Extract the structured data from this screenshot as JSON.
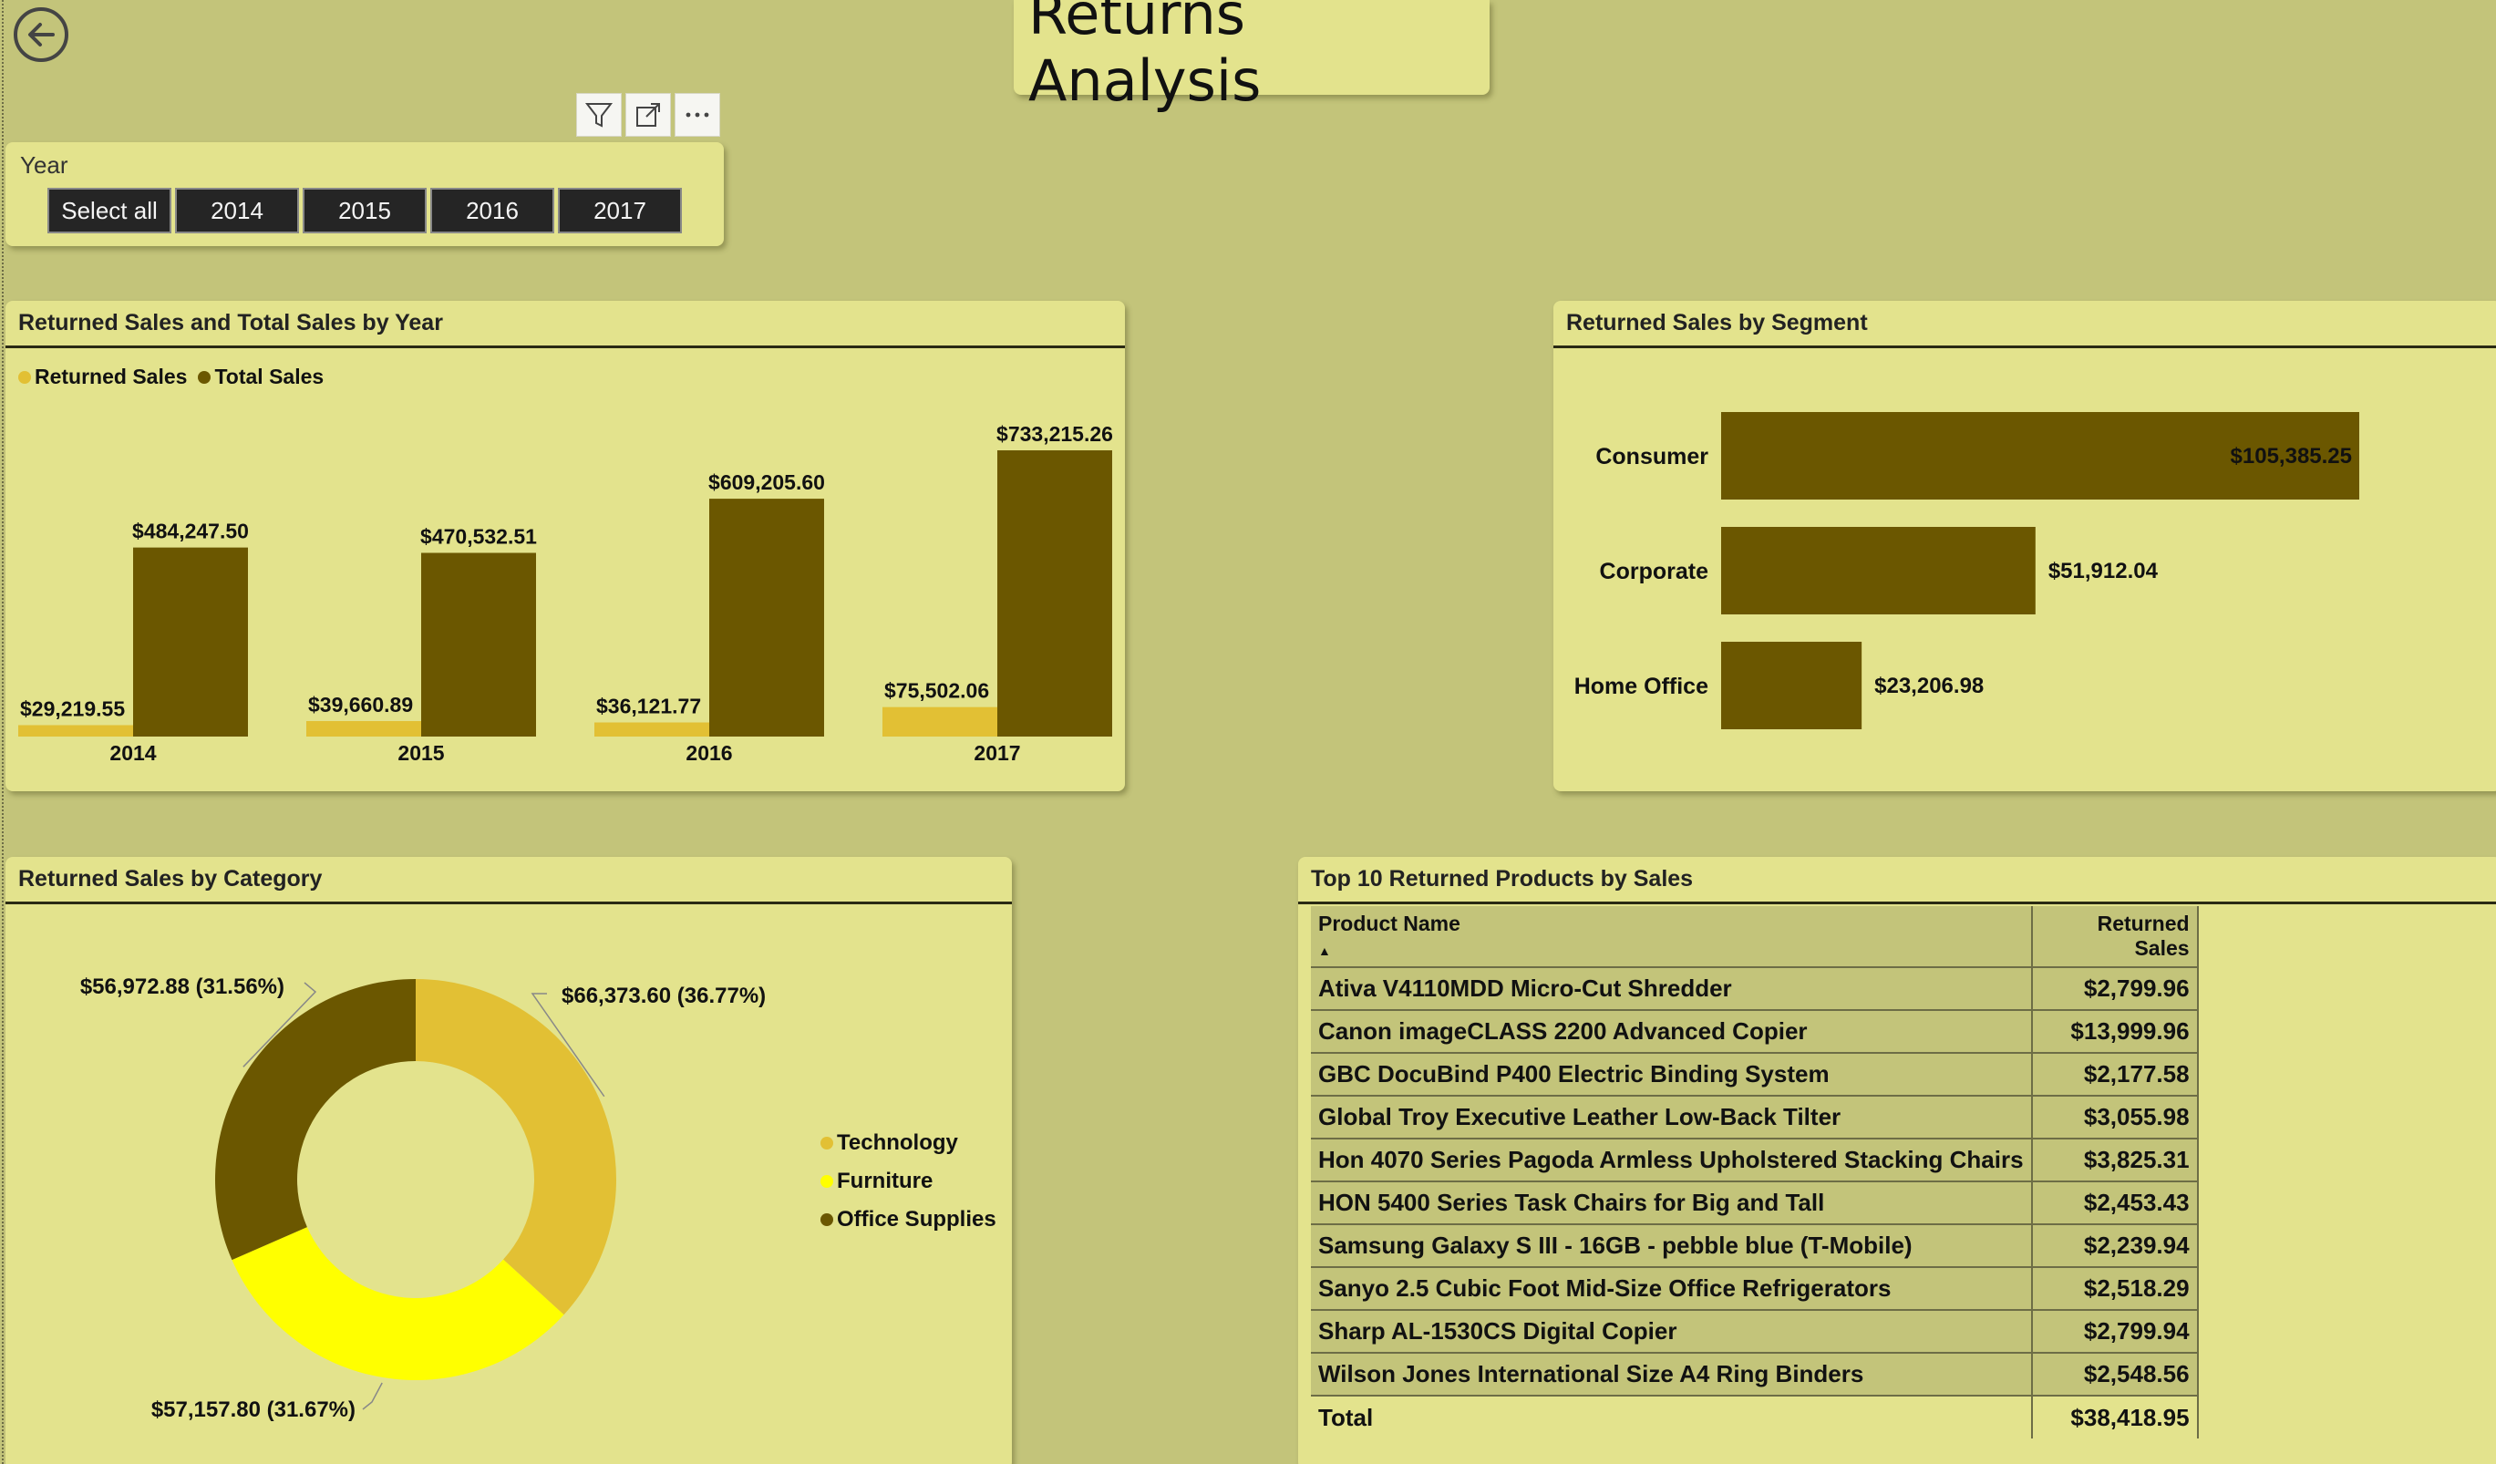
{
  "page": {
    "title": "Returns Analysis"
  },
  "colors": {
    "background": "#c3c47a",
    "card": "#e3e38d",
    "dark_bar": "#6b5700",
    "returned": "#e2c034",
    "furniture": "#ffff00"
  },
  "icons": {
    "back": "back-arrow-icon",
    "filter": "filter-icon",
    "focus": "focus-mode-icon",
    "more": "more-options-icon"
  },
  "slicer": {
    "label": "Year",
    "options": [
      "Select all",
      "2014",
      "2015",
      "2016",
      "2017"
    ]
  },
  "sales_by_year": {
    "title": "Returned Sales and Total Sales by Year",
    "legend": [
      "Returned Sales",
      "Total Sales"
    ],
    "chart_data": {
      "type": "bar",
      "categories": [
        "2014",
        "2015",
        "2016",
        "2017"
      ],
      "series": [
        {
          "name": "Returned Sales",
          "values": [
            29219.55,
            39660.89,
            36121.77,
            75502.06
          ],
          "labels": [
            "$29,219.55",
            "$39,660.89",
            "$36,121.77",
            "$75,502.06"
          ]
        },
        {
          "name": "Total Sales",
          "values": [
            484247.5,
            470532.51,
            609205.6,
            733215.26
          ],
          "labels": [
            "$484,247.50",
            "$470,532.51",
            "$609,205.60",
            "$733,215.26"
          ]
        }
      ],
      "ylim": [
        0,
        733215.26
      ]
    }
  },
  "sales_by_segment": {
    "title": "Returned Sales by Segment",
    "chart_data": {
      "type": "bar",
      "categories": [
        "Consumer",
        "Corporate",
        "Home Office"
      ],
      "values": [
        105385.25,
        51912.04,
        23206.98
      ],
      "labels": [
        "$105,385.25",
        "$51,912.04",
        "$23,206.98"
      ],
      "xlim": [
        0,
        105385.25
      ]
    }
  },
  "sales_by_category": {
    "title": "Returned Sales by Category",
    "legend": [
      "Technology",
      "Furniture",
      "Office Supplies"
    ],
    "chart_data": {
      "type": "pie",
      "categories": [
        "Technology",
        "Furniture",
        "Office Supplies"
      ],
      "values": [
        66373.6,
        57157.8,
        56972.88
      ],
      "labels": [
        "$66,373.60 (36.77%)",
        "$57,157.80 (31.67%)",
        "$56,972.88 (31.56%)"
      ],
      "colors": [
        "#e2c034",
        "#ffff00",
        "#6b5700"
      ]
    }
  },
  "top_products": {
    "title": "Top 10 Returned Products by Sales",
    "columns": [
      "Product Name",
      "Returned Sales"
    ],
    "sort_indicator": "▲",
    "rows": [
      [
        "Ativa V4110MDD Micro-Cut Shredder",
        "$2,799.96"
      ],
      [
        "Canon imageCLASS 2200 Advanced Copier",
        "$13,999.96"
      ],
      [
        "GBC DocuBind P400 Electric Binding System",
        "$2,177.58"
      ],
      [
        "Global Troy Executive Leather Low-Back Tilter",
        "$3,055.98"
      ],
      [
        "Hon 4070 Series Pagoda Armless Upholstered Stacking Chairs",
        "$3,825.31"
      ],
      [
        "HON 5400 Series Task Chairs for Big and Tall",
        "$2,453.43"
      ],
      [
        "Samsung Galaxy S III - 16GB - pebble blue (T-Mobile)",
        "$2,239.94"
      ],
      [
        "Sanyo 2.5 Cubic Foot Mid-Size Office Refrigerators",
        "$2,518.29"
      ],
      [
        "Sharp AL-1530CS Digital Copier",
        "$2,799.94"
      ],
      [
        "Wilson Jones International Size A4 Ring Binders",
        "$2,548.56"
      ]
    ],
    "total_label": "Total",
    "total_value": "$38,418.95"
  }
}
